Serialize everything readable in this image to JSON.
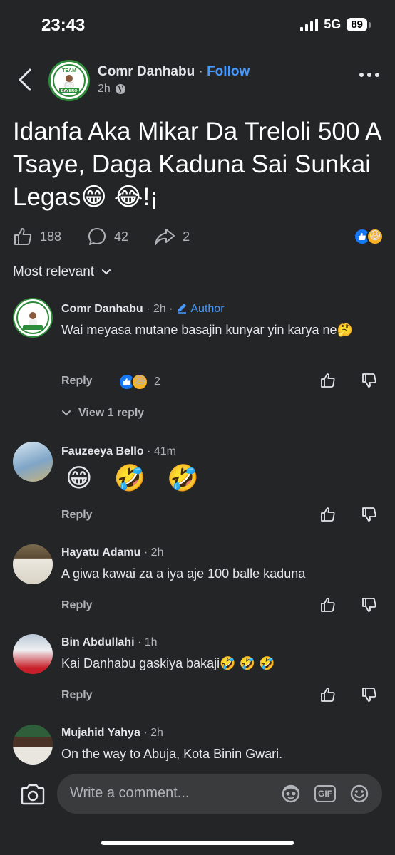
{
  "status_bar": {
    "time": "23:43",
    "network": "5G",
    "battery": "89"
  },
  "post": {
    "author": "Comr Danhabu",
    "separator": "·",
    "follow_label": "Follow",
    "time": "2h",
    "logo_top_text": "TEAM",
    "logo_bottom_text": "BAYERO",
    "text": "Idanfa Aka Mikar Da Treloli 500 A Tsaye, Daga Kaduna Sai Sunkai Legas😁 😂!¡",
    "likes": "188",
    "comments": "42",
    "shares": "2"
  },
  "sort_label": "Most relevant",
  "comments": [
    {
      "name": "Comr Danhabu",
      "time": "· 2h ·",
      "badge": "Author",
      "text": "Wai meyasa mutane basajin kunyar yin karya ne🤔",
      "reply_label": "Reply",
      "reaction_count": "2",
      "view_replies": "View 1 reply"
    },
    {
      "name": "Fauzeeya Bello",
      "time": "· 41m",
      "text": "😁 🤣 🤣",
      "reply_label": "Reply"
    },
    {
      "name": "Hayatu Adamu",
      "time": "· 2h",
      "text": "A giwa kawai za a iya aje 100 balle kaduna",
      "reply_label": "Reply"
    },
    {
      "name": "Bin Abdullahi",
      "time": "· 1h",
      "text": "Kai Danhabu gaskiya bakaji🤣 🤣 🤣",
      "reply_label": "Reply"
    },
    {
      "name": "Mujahid Yahya",
      "time": "· 2h",
      "text": "On the way to Abuja, Kota Binin Gwari."
    }
  ],
  "composer": {
    "placeholder": "Write a comment...",
    "gif_label": "GIF"
  },
  "colors": {
    "background": "#242526",
    "link": "#4599ff",
    "logo_green": "#2e8b3a"
  }
}
